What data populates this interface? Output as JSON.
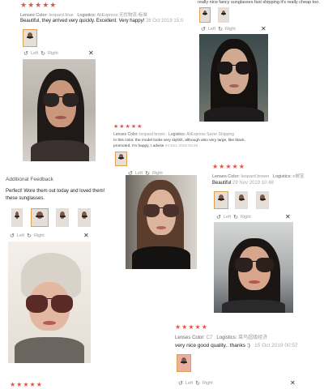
{
  "colors": {
    "accent_star": "#e8533f",
    "accent_orange": "#e0a050"
  },
  "review1": {
    "stars": "★★★★★",
    "lenses_key": "Lenses Color:",
    "lenses_val": "leopard blue",
    "logistics_key": "Logistics:",
    "logistics_val": "AliExpress 无忧物流-标准",
    "text": "Beautiful, they arrived very quickly. Excellent. Very happy!",
    "date": "28 Oct 2019 15:0",
    "left": "Left",
    "right": "Right"
  },
  "review2": {
    "text": "really nice fancy sunglasses fast shipping it's really cheap too.",
    "left": "Left",
    "right": "Right"
  },
  "review3": {
    "stars": "★★★★★",
    "lenses_key": "Lenses Color:",
    "lenses_val": "leopard brown",
    "logistics_key": "Logistics:",
    "logistics_val": "AliExpress Saver Shipping",
    "text_line1": "In this color, the model looks very stylish, although also very large, like black,",
    "text_line2": "promoted. I'm happy, I advise",
    "date": "04 Dec 2019 03:45",
    "left": "Left",
    "right": "Right"
  },
  "review4": {
    "heading": "Additional Feedback",
    "text_line1": "Perfect! Wore them out today and loved them!",
    "text_line2": "these sunglasses.",
    "left": "Left",
    "right": "Right"
  },
  "review5": {
    "stars": "★★★★★",
    "lenses_key": "Lenses Color:",
    "lenses_val": "leopard brown",
    "logistics_key": "Logistics:",
    "logistics_val": "e邮宝",
    "text": "Beautiful",
    "date": "29 Nov 2019 10:48",
    "left": "Left",
    "right": "Right"
  },
  "review6": {
    "stars": "★★★★★",
    "lenses_key": "Lenses Color:",
    "lenses_val": "C7",
    "logistics_key": "Logistics:",
    "logistics_val": "菜鸟超级经济",
    "text": "very nice good quality.. thanks :)",
    "date": "15 Oct 2019 00:57",
    "left": "Left",
    "right": "Right"
  },
  "review7": {
    "stars": "★★★★★"
  }
}
